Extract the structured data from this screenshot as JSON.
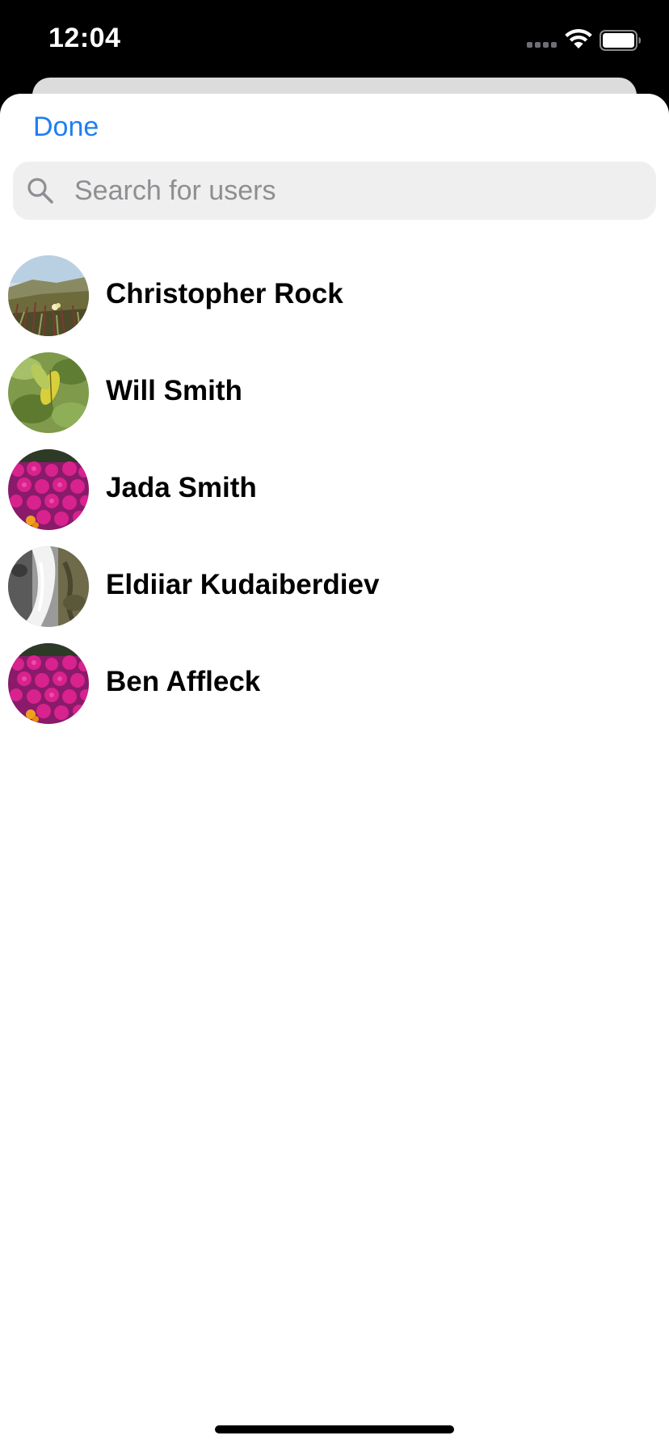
{
  "status_bar": {
    "time": "12:04",
    "icons": [
      "cellular-signal-icon",
      "wifi-icon",
      "battery-icon"
    ]
  },
  "header": {
    "done_label": "Done",
    "accent_color": "#1f7ef2"
  },
  "search": {
    "placeholder": "Search for users",
    "value": "",
    "icon": "search-icon"
  },
  "users": [
    {
      "name": "Christopher Rock",
      "avatar": "grass-field-photo"
    },
    {
      "name": "Will Smith",
      "avatar": "green-leaves-photo"
    },
    {
      "name": "Jada Smith",
      "avatar": "pink-flowers-photo"
    },
    {
      "name": "Eldiiar Kudaiberdiev",
      "avatar": "waterfall-photo"
    },
    {
      "name": "Ben Affleck",
      "avatar": "pink-flowers-photo"
    }
  ]
}
